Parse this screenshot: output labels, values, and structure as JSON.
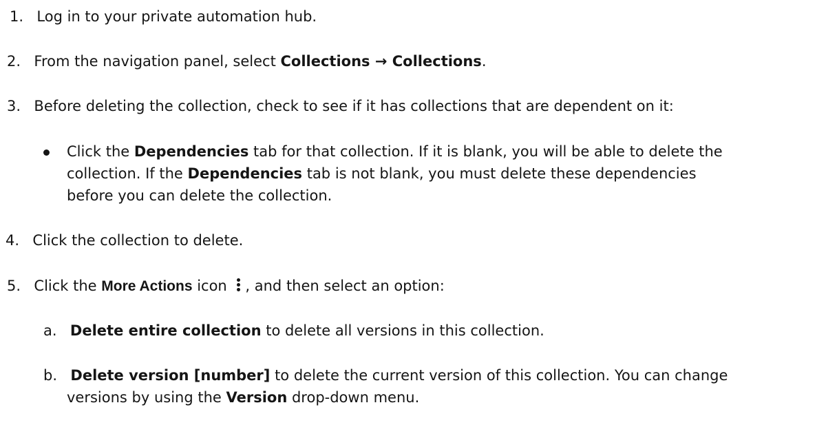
{
  "steps": [
    {
      "number": "1.",
      "text": "Log in to your private automation hub."
    },
    {
      "number": "2.",
      "text_before": "From the navigation panel, select ",
      "bold_1": "Collections",
      "arrow": " → ",
      "bold_2": "Collections",
      "text_after": "."
    },
    {
      "number": "3.",
      "text": "Before deleting the collection, check to see if it has collections that are dependent on it:",
      "bullet": {
        "line1_before": "Click the ",
        "line1_bold": "Dependencies",
        "line1_after": " tab for that collection. If it is blank, you will be able to delete the",
        "line2_before": "collection. If the ",
        "line2_bold": "Dependencies",
        "line2_after": " tab is not blank, you must delete these dependencies",
        "line3": "before you can delete the collection."
      }
    },
    {
      "number": "4.",
      "text": "Click the collection to delete."
    },
    {
      "number": "5.",
      "text_before": "Click the ",
      "bold": "More Actions",
      "text_mid": " icon ",
      "icon": "kebab-icon",
      "text_after": ", and then select an option:",
      "substeps": [
        {
          "letter": "a.",
          "bold": "Delete entire collection",
          "text": " to delete all versions in this collection."
        },
        {
          "letter": "b.",
          "bold": "Delete version [number]",
          "text": " to delete the current version of this collection. You can change",
          "line2_before": "versions by using the ",
          "line2_bold": "Version",
          "line2_after": " drop-down menu."
        }
      ]
    }
  ]
}
